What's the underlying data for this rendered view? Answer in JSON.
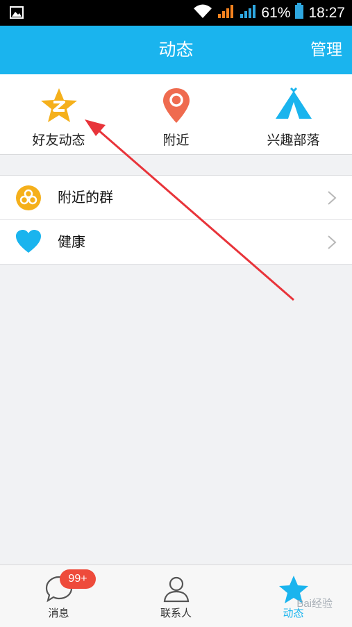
{
  "status_bar": {
    "battery_percent": "61%",
    "time": "18:27"
  },
  "header": {
    "title": "动态",
    "manage_label": "管理"
  },
  "top_nav": [
    {
      "label": "好友动态",
      "icon": "qzone-star-icon"
    },
    {
      "label": "附近",
      "icon": "location-pin-icon"
    },
    {
      "label": "兴趣部落",
      "icon": "tent-icon"
    }
  ],
  "list": [
    {
      "label": "附近的群",
      "icon": "group-circles-icon"
    },
    {
      "label": "健康",
      "icon": "heart-icon"
    }
  ],
  "bottom_tabs": [
    {
      "label": "消息",
      "icon": "chat-bubble-icon",
      "badge": "99+"
    },
    {
      "label": "联系人",
      "icon": "contact-person-icon"
    },
    {
      "label": "动态",
      "icon": "star-icon",
      "active": true
    }
  ],
  "watermark": "Bai经验",
  "colors": {
    "header_bg": "#1ab4ee",
    "active_tab": "#1ab4ee",
    "badge": "#ee4b3b",
    "annotation_arrow": "#e8343a"
  }
}
